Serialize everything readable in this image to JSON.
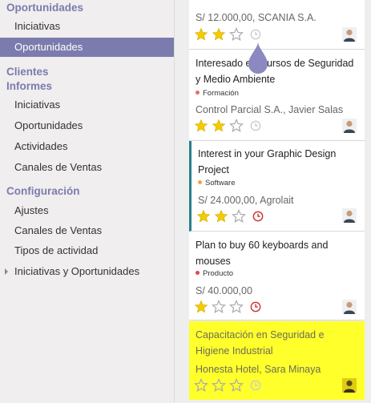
{
  "sidebar": {
    "oportunidades_section": "Oportunidades",
    "oportunidades_items": [
      "Iniciativas",
      "Oportunidades"
    ],
    "clientes_section": "Clientes",
    "informes_section": "Informes",
    "informes_items": [
      "Iniciativas",
      "Oportunidades",
      "Actividades",
      "Canales de Ventas"
    ],
    "config_section": "Configuración",
    "config_items": [
      "Ajustes",
      "Canales de Ventas",
      "Tipos de actividad",
      "Iniciativas y Oportunidades"
    ]
  },
  "cards": [
    {
      "amount_line": "S/ 12.000,00, SCANIA S.A.",
      "priority": 2,
      "activity": "none"
    },
    {
      "title": "Interesado en Cursos de Seguridad y Medio Ambiente",
      "tag": "Formación",
      "tag_color": "#e2706a",
      "info": "Control Parcial S.A., Javier Salas",
      "priority": 2,
      "activity": "none"
    },
    {
      "title": "Interest in your Graphic Design Project",
      "tag": "Software",
      "tag_color": "#f0a24a",
      "info": "S/ 24.000,00, Agrolait",
      "priority": 2,
      "activity": "overdue"
    },
    {
      "title": "Plan to buy 60 keyboards and mouses",
      "tag": "Producto",
      "tag_color": "#e04848",
      "info": "S/ 40.000,00",
      "priority": 1,
      "activity": "overdue"
    },
    {
      "title": "Capacitación en Seguridad e Higiene Industrial",
      "info": "Honesta Hotel, Sara Minaya",
      "priority": 0,
      "activity": "none"
    }
  ],
  "colors": {
    "brand": "#7c7bad",
    "star_filled": "#f3cc00",
    "star_empty": "#aaaaaa",
    "clock_none": "#cccccc",
    "clock_overdue": "#cc3333",
    "highlight": "#ffff2b",
    "card_accent": "#26808e"
  },
  "icons": {
    "star": "star-icon",
    "clock": "clock-icon",
    "avatar": "user-avatar",
    "caret": "caret-right-icon"
  }
}
